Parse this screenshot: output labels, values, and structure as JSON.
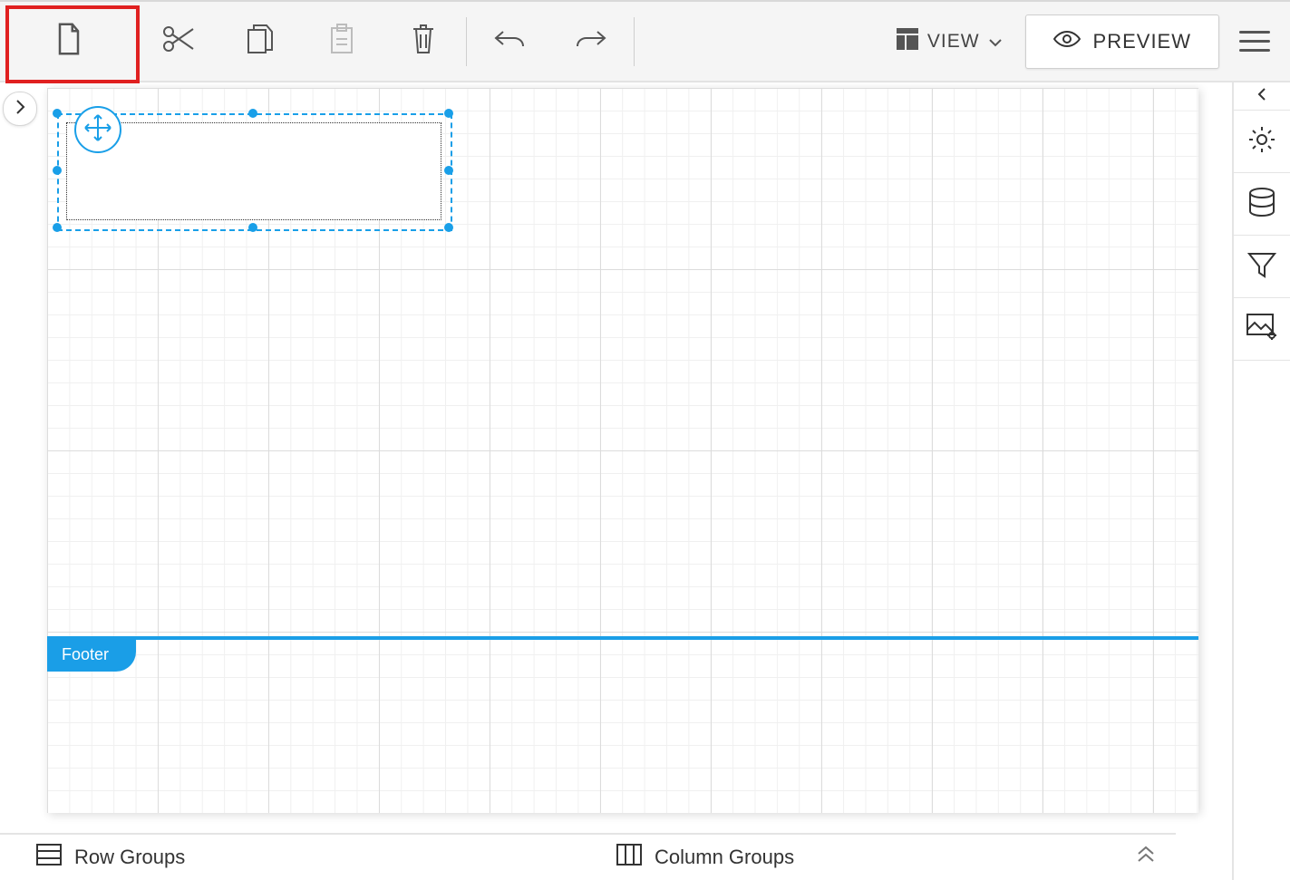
{
  "toolbar": {
    "view_label": "VIEW",
    "preview_label": "PREVIEW"
  },
  "canvas": {
    "footer_label": "Footer"
  },
  "groups": {
    "row_label": "Row Groups",
    "col_label": "Column Groups"
  },
  "colors": {
    "accent": "#1a9ee7",
    "highlight": "#e02020"
  }
}
